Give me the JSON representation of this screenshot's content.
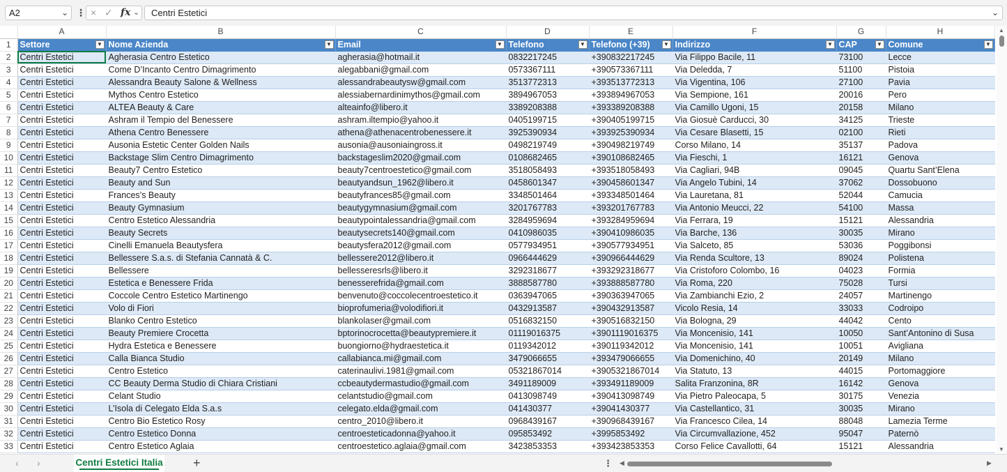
{
  "formula_bar": {
    "name_box": "A2",
    "cancel_icon": "×",
    "enter_icon": "✓",
    "fx_label": "fx",
    "formula": "Centri Estetici"
  },
  "columns": [
    {
      "letter": "A"
    },
    {
      "letter": "B"
    },
    {
      "letter": "C"
    },
    {
      "letter": "D"
    },
    {
      "letter": "E"
    },
    {
      "letter": "F"
    },
    {
      "letter": "G"
    },
    {
      "letter": "H"
    }
  ],
  "header_row": {
    "num": "1",
    "cells": [
      "Settore",
      "Nome Azienda",
      "Email",
      "Telefono",
      "Telefono (+39)",
      "Indirizzo",
      "CAP",
      "Comune"
    ]
  },
  "rows": [
    {
      "num": "2",
      "cells": [
        "Centri Estetici",
        "Agherasia Centro Estetico",
        "agherasia@hotmail.it",
        "0832217245",
        "+390832217245",
        "Via Filippo Bacile, 11",
        "73100",
        "Lecce"
      ]
    },
    {
      "num": "3",
      "cells": [
        "Centri Estetici",
        "Come D’Incanto Centro Dimagrimento",
        "alegabbani@gmail.com",
        "0573367111",
        "+390573367111",
        "Via Deledda, 7",
        "51100",
        "Pistoia"
      ]
    },
    {
      "num": "4",
      "cells": [
        "Centri Estetici",
        "Alessandra Beauty Salone & Wellness",
        "alessandrabeautysw@gmail.com",
        "3513772313",
        "+393513772313",
        "Via Vigentina, 106",
        "27100",
        "Pavia"
      ]
    },
    {
      "num": "5",
      "cells": [
        "Centri Estetici",
        "Mythos Centro Estetico",
        "alessiabernardinimythos@gmail.com",
        "3894967053",
        "+393894967053",
        "Via Sempione, 161",
        "20016",
        "Pero"
      ]
    },
    {
      "num": "6",
      "cells": [
        "Centri Estetici",
        "ALTEA Beauty & Care",
        "alteainfo@libero.it",
        "3389208388",
        "+393389208388",
        "Via Camillo Ugoni, 15",
        "20158",
        "Milano"
      ]
    },
    {
      "num": "7",
      "cells": [
        "Centri Estetici",
        "Ashram il Tempio del Benessere",
        "ashram.iltempio@yahoo.it",
        "0405199715",
        "+390405199715",
        "Via Giosuè Carducci, 30",
        "34125",
        "Trieste"
      ]
    },
    {
      "num": "8",
      "cells": [
        "Centri Estetici",
        "Athena Centro Benessere",
        "athena@athenacentrobenessere.it",
        "3925390934",
        "+393925390934",
        "Via Cesare Blasetti, 15",
        "02100",
        "Rieti"
      ]
    },
    {
      "num": "9",
      "cells": [
        "Centri Estetici",
        "Ausonia Estetic Center Golden Nails",
        "ausonia@ausoniaingross.it",
        "0498219749",
        "+390498219749",
        "Corso Milano, 14",
        "35137",
        "Padova"
      ]
    },
    {
      "num": "10",
      "cells": [
        "Centri Estetici",
        "Backstage Slim Centro Dimagrimento",
        "backstageslim2020@gmail.com",
        "0108682465",
        "+390108682465",
        "Via Fieschi, 1",
        "16121",
        "Genova"
      ]
    },
    {
      "num": "11",
      "cells": [
        "Centri Estetici",
        "Beauty7 Centro Estetico",
        "beauty7centroestetico@gmail.com",
        "3518058493",
        "+393518058493",
        "Via Cagliari, 94B",
        "09045",
        "Quartu Sant’Elena"
      ]
    },
    {
      "num": "12",
      "cells": [
        "Centri Estetici",
        "Beauty and Sun",
        "beautyandsun_1962@libero.it",
        "0458601347",
        "+390458601347",
        "Via Angelo Tubini, 14",
        "37062",
        "Dossobuono"
      ]
    },
    {
      "num": "13",
      "cells": [
        "Centri Estetici",
        "Frances’s Beauty",
        "beautyfrances85@gmail.com",
        "3348501464",
        "+393348501464",
        "Via Lauretana, 81",
        "52044",
        "Camucia"
      ]
    },
    {
      "num": "14",
      "cells": [
        "Centri Estetici",
        "Beauty Gymnasium",
        "beautygymnasium@gmail.com",
        "3201767783",
        "+393201767783",
        "Via Antonio Meucci, 22",
        "54100",
        "Massa"
      ]
    },
    {
      "num": "15",
      "cells": [
        "Centri Estetici",
        "Centro Estetico Alessandria",
        "beautypointalessandria@gmail.com",
        "3284959694",
        "+393284959694",
        "Via Ferrara, 19",
        "15121",
        "Alessandria"
      ]
    },
    {
      "num": "16",
      "cells": [
        "Centri Estetici",
        "Beauty Secrets",
        "beautysecrets140@gmail.com",
        "0410986035",
        "+390410986035",
        "Via Barche, 136",
        "30035",
        "Mirano"
      ]
    },
    {
      "num": "17",
      "cells": [
        "Centri Estetici",
        "Cinelli Emanuela Beautysfera",
        "beautysfera2012@gmail.com",
        "0577934951",
        "+390577934951",
        "Via Salceto, 85",
        "53036",
        "Poggibonsi"
      ]
    },
    {
      "num": "18",
      "cells": [
        "Centri Estetici",
        "Bellessere S.a.s. di Stefania Cannatà & C.",
        "bellessere2012@libero.it",
        "0966444629",
        "+390966444629",
        "Via Renda Scultore, 13",
        "89024",
        "Polistena"
      ]
    },
    {
      "num": "19",
      "cells": [
        "Centri Estetici",
        "Bellessere",
        "bellesseresrls@libero.it",
        "3292318677",
        "+393292318677",
        "Via Cristoforo Colombo, 16",
        "04023",
        "Formia"
      ]
    },
    {
      "num": "20",
      "cells": [
        "Centri Estetici",
        "Estetica e Benessere Frida",
        "benesserefrida@gmail.com",
        "3888587780",
        "+393888587780",
        "Via Roma, 220",
        "75028",
        "Tursi"
      ]
    },
    {
      "num": "21",
      "cells": [
        "Centri Estetici",
        "Coccole Centro Estetico Martinengo",
        "benvenuto@coccolecentroestetico.it",
        "0363947065",
        "+390363947065",
        "Via Zambianchi Ezio, 2",
        "24057",
        "Martinengo"
      ]
    },
    {
      "num": "22",
      "cells": [
        "Centri Estetici",
        "Volo di Fiori",
        "bioprofumeria@volodifiori.it",
        "0432913587",
        "+390432913587",
        "Vicolo Resia, 14",
        "33033",
        "Codroipo"
      ]
    },
    {
      "num": "23",
      "cells": [
        "Centri Estetici",
        "Blanko Centro Estetico",
        "blankolaser@gmail.com",
        "0516832150",
        "+390516832150",
        "Via Bologna, 29",
        "44042",
        "Cento"
      ]
    },
    {
      "num": "24",
      "cells": [
        "Centri Estetici",
        "Beauty Premiere Crocetta",
        "bptorinocrocetta@beautypremiere.it",
        "01119016375",
        "+3901119016375",
        "Via Moncenisio, 141",
        "10050",
        "Sant’Antonino di Susa"
      ]
    },
    {
      "num": "25",
      "cells": [
        "Centri Estetici",
        "Hydra Estetica e Benessere",
        "buongiorno@hydraestetica.it",
        "0119342012",
        "+390119342012",
        "Via Moncenisio, 141",
        "10051",
        "Avigliana"
      ]
    },
    {
      "num": "26",
      "cells": [
        "Centri Estetici",
        "Calla Bianca Studio",
        "callabianca.mi@gmail.com",
        "3479066655",
        "+393479066655",
        "Via Domenichino, 40",
        "20149",
        "Milano"
      ]
    },
    {
      "num": "27",
      "cells": [
        "Centri Estetici",
        "Centro Estetico",
        "caterinaulivi.1981@gmail.com",
        "05321867014",
        "+3905321867014",
        "Via Statuto, 13",
        "44015",
        "Portomaggiore"
      ]
    },
    {
      "num": "28",
      "cells": [
        "Centri Estetici",
        "CC Beauty Derma Studio di Chiara Cristiani",
        "ccbeautydermastudio@gmail.com",
        "3491189009",
        "+393491189009",
        "Salita Franzonina, 8R",
        "16142",
        "Genova"
      ]
    },
    {
      "num": "29",
      "cells": [
        "Centri Estetici",
        "Celant Studio",
        "celantstudio@gmail.com",
        "0413098749",
        "+390413098749",
        "Via Pietro Paleocapa, 5",
        "30175",
        "Venezia"
      ]
    },
    {
      "num": "30",
      "cells": [
        "Centri Estetici",
        "L’Isola di Celegato Elda S.a.s",
        "celegato.elda@gmail.com",
        "041430377",
        "+39041430377",
        "Via Castellantico, 31",
        "30035",
        "Mirano"
      ]
    },
    {
      "num": "31",
      "cells": [
        "Centri Estetici",
        "Centro Bio Estetico Rosy",
        "centro_2010@libero.it",
        "0968439167",
        "+390968439167",
        "Via Francesco Cilea, 14",
        "88048",
        "Lamezia Terme"
      ]
    },
    {
      "num": "32",
      "cells": [
        "Centri Estetici",
        "Centro Estetico Donna",
        "centroesteticadonna@yahoo.it",
        "095853492",
        "+3995853492",
        "Via Circumvallazione, 452",
        "95047",
        "Paternò"
      ]
    },
    {
      "num": "33",
      "cells": [
        "Centri Estetici",
        "Centro Estetico Aglaia",
        "centroestetico.aglaia@gmail.com",
        "3423853353",
        "+393423853353",
        "Corso Felice Cavallotti, 64",
        "15121",
        "Alessandria"
      ]
    }
  ],
  "sheet_tabs": [
    "Centri Estetici Italia"
  ],
  "selected_cell": "A2",
  "colors": {
    "header_fill": "#4a86c8",
    "band_fill": "#dde9f6",
    "accent": "#107c41"
  }
}
